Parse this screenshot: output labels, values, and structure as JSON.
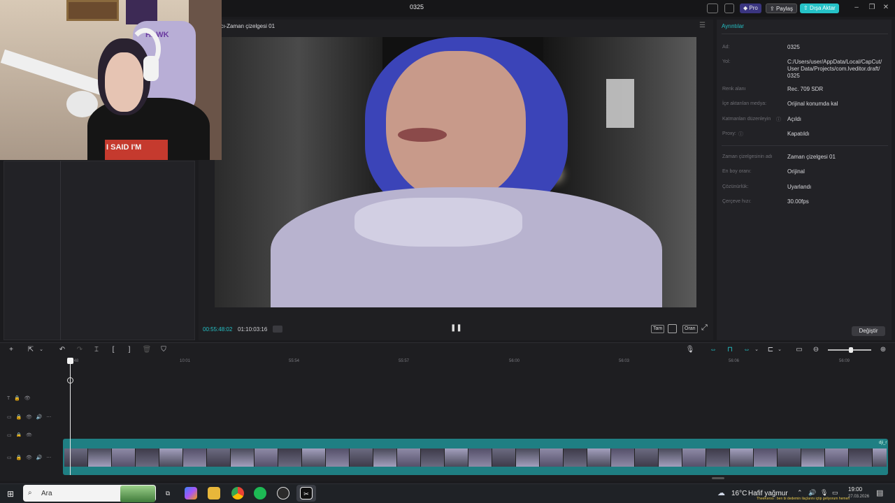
{
  "app": {
    "title": "0325",
    "pro_label": "Pro",
    "share_label": "Paylaş",
    "export_label": "Dışa Aktar",
    "accent": "#25c2c7"
  },
  "player": {
    "title": "ıcı-Zaman çizelgesi 01",
    "time_current": "00:55:48:02",
    "time_total": "01:10:03:16",
    "fit_label": "Tam",
    "ratio_label": "Oran"
  },
  "details": {
    "title": "Ayrıntılar",
    "rows": [
      {
        "label": "Ad:",
        "value": "0325"
      },
      {
        "label": "Yol:",
        "value": "C:/Users/user/AppData/Local/CapCut/ User Data/Projects/com.lveditor.draft/ 0325"
      },
      {
        "label": "Renk alanı",
        "value": "Rec. 709 SDR"
      },
      {
        "label": "İçe aktarılan medya:",
        "value": "Orijinal konumda kal"
      },
      {
        "label": "Katmanları düzenleyin",
        "value": "Açıldı"
      },
      {
        "label": "Proxy:",
        "value": "Kapatıldı"
      },
      {
        "label": "Zaman çizelgesinin adı",
        "value": "Zaman çizelgesi 01"
      },
      {
        "label": "En boy oranı:",
        "value": "Orijinal"
      },
      {
        "label": "Çözünürlük:",
        "value": "Uyarlandı"
      },
      {
        "label": "Çerçeve hızı:",
        "value": "30.00fps"
      }
    ],
    "apply_label": "Değiştir"
  },
  "timeline": {
    "ticks": [
      ":48",
      "10:01",
      "55:54",
      "55:57",
      "56:00",
      "56:03",
      "56:06",
      "56:09"
    ],
    "clip_label": "dji_r"
  },
  "webcam": {
    "sign_text": "HAWK",
    "shirt_text": "I SAID I'M"
  },
  "taskbar": {
    "search_placeholder": "Ara",
    "temperature": "16°C",
    "weather": "Hafif yağmur",
    "ticker": "TheeKeroo : ben bi dedemin ilaçlarını içtip geliyorum hemen",
    "time": "19:00",
    "date": "27.03.2026"
  }
}
